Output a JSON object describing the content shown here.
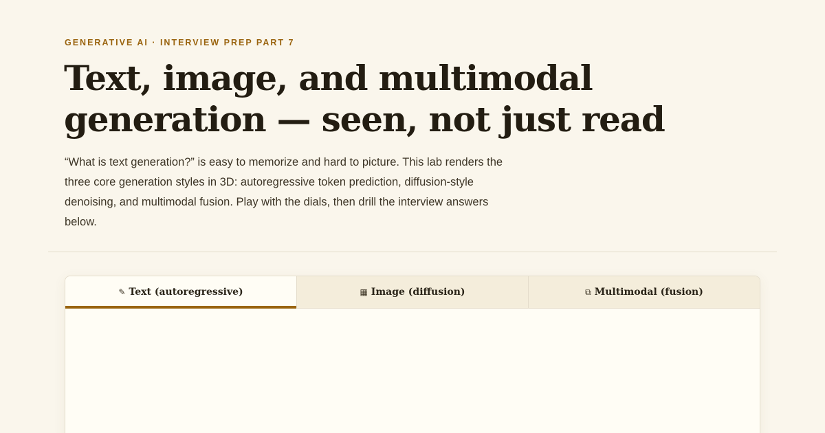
{
  "header": {
    "eyebrow": "GENERATIVE AI · INTERVIEW PREP PART 7",
    "title_line1": "Text, image, and multimodal",
    "title_line2": "generation — seen, not just read",
    "lede": "“What is text generation?” is easy to memorize and hard to picture. This lab renders the three core generation styles in 3D: autoregressive token prediction, diffusion-style denoising, and multimodal fusion. Play with the dials, then drill the interview answers below."
  },
  "tabs": [
    {
      "label": "Text (autoregressive)",
      "icon": "✎",
      "icon_name": "pencil-icon",
      "active": true
    },
    {
      "label": "Image (diffusion)",
      "icon": "▦",
      "icon_name": "grid-icon",
      "active": false
    },
    {
      "label": "Multimodal (fusion)",
      "icon": "⧉",
      "icon_name": "overlap-squares-icon",
      "active": false
    }
  ],
  "colors": {
    "accent": "#9a640f",
    "background": "#faf6ec",
    "panel": "#fffdf5",
    "tab_inactive": "#f4eddb"
  }
}
